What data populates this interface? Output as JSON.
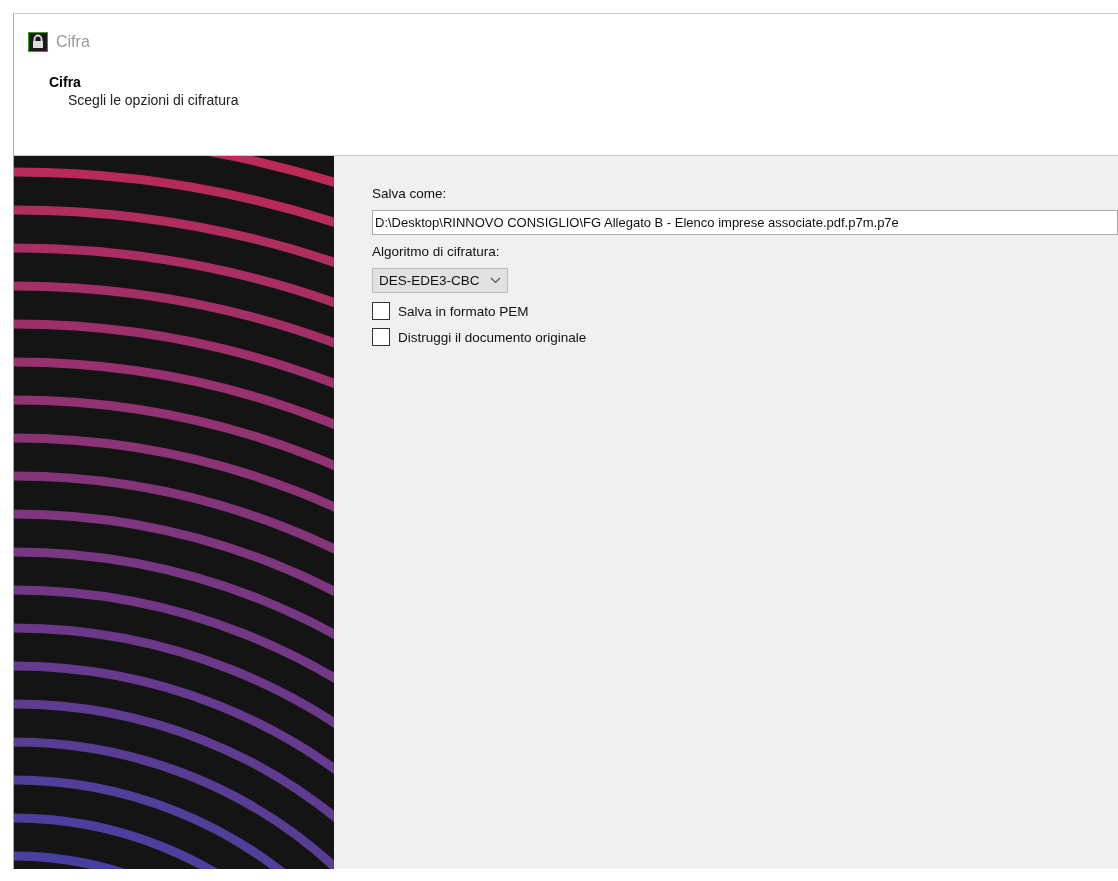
{
  "window": {
    "title": "Cifra"
  },
  "header": {
    "title": "Cifra",
    "subtitle": "Scegli le opzioni di cifratura"
  },
  "form": {
    "save_as_label": "Salva come:",
    "save_as_value": "D:\\Desktop\\RINNOVO CONSIGLIO\\FG Allegato B - Elenco imprese associate.pdf.p7m.p7e",
    "algorithm_label": "Algoritmo di cifratura:",
    "algorithm_value": "DES-EDE3-CBC",
    "options": [
      {
        "label": "Salva in formato PEM",
        "checked": false
      },
      {
        "label": "Distruggi il documento originale",
        "checked": false
      }
    ]
  }
}
